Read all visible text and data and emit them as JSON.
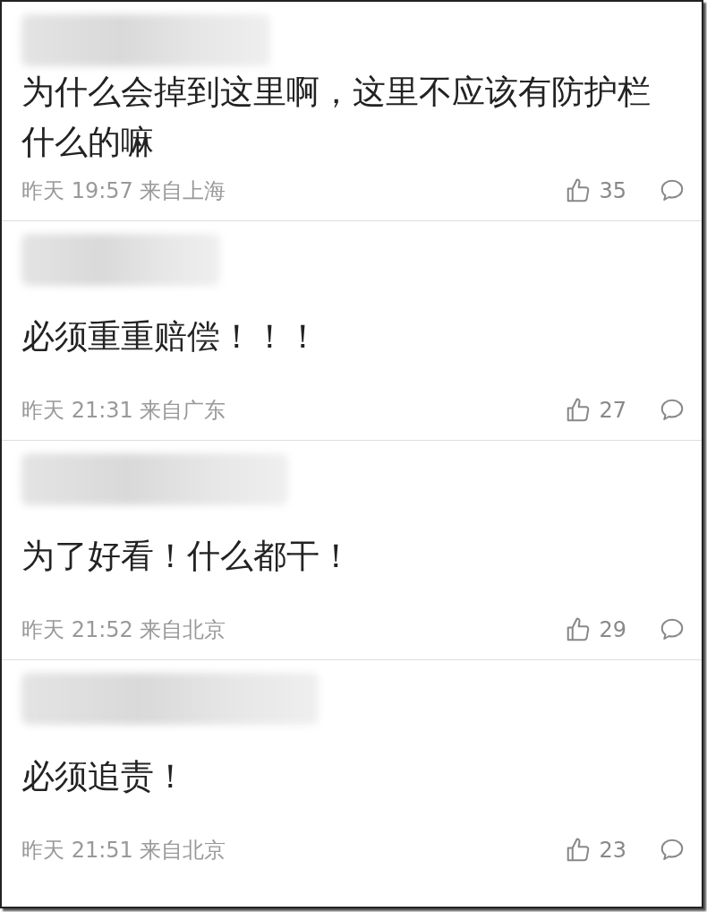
{
  "comments": [
    {
      "text": "为什么会掉到这里啊，这里不应该有防护栏什么的嘛",
      "time": "昨天 19:57 来自上海",
      "likes": "35"
    },
    {
      "text": "必须重重赔偿！！！",
      "time": "昨天 21:31 来自广东",
      "likes": "27"
    },
    {
      "text": "为了好看！什么都干！",
      "time": "昨天 21:52 来自北京",
      "likes": "29"
    },
    {
      "text": "必须追责！",
      "time": "昨天 21:51 来自北京",
      "likes": "23"
    }
  ]
}
